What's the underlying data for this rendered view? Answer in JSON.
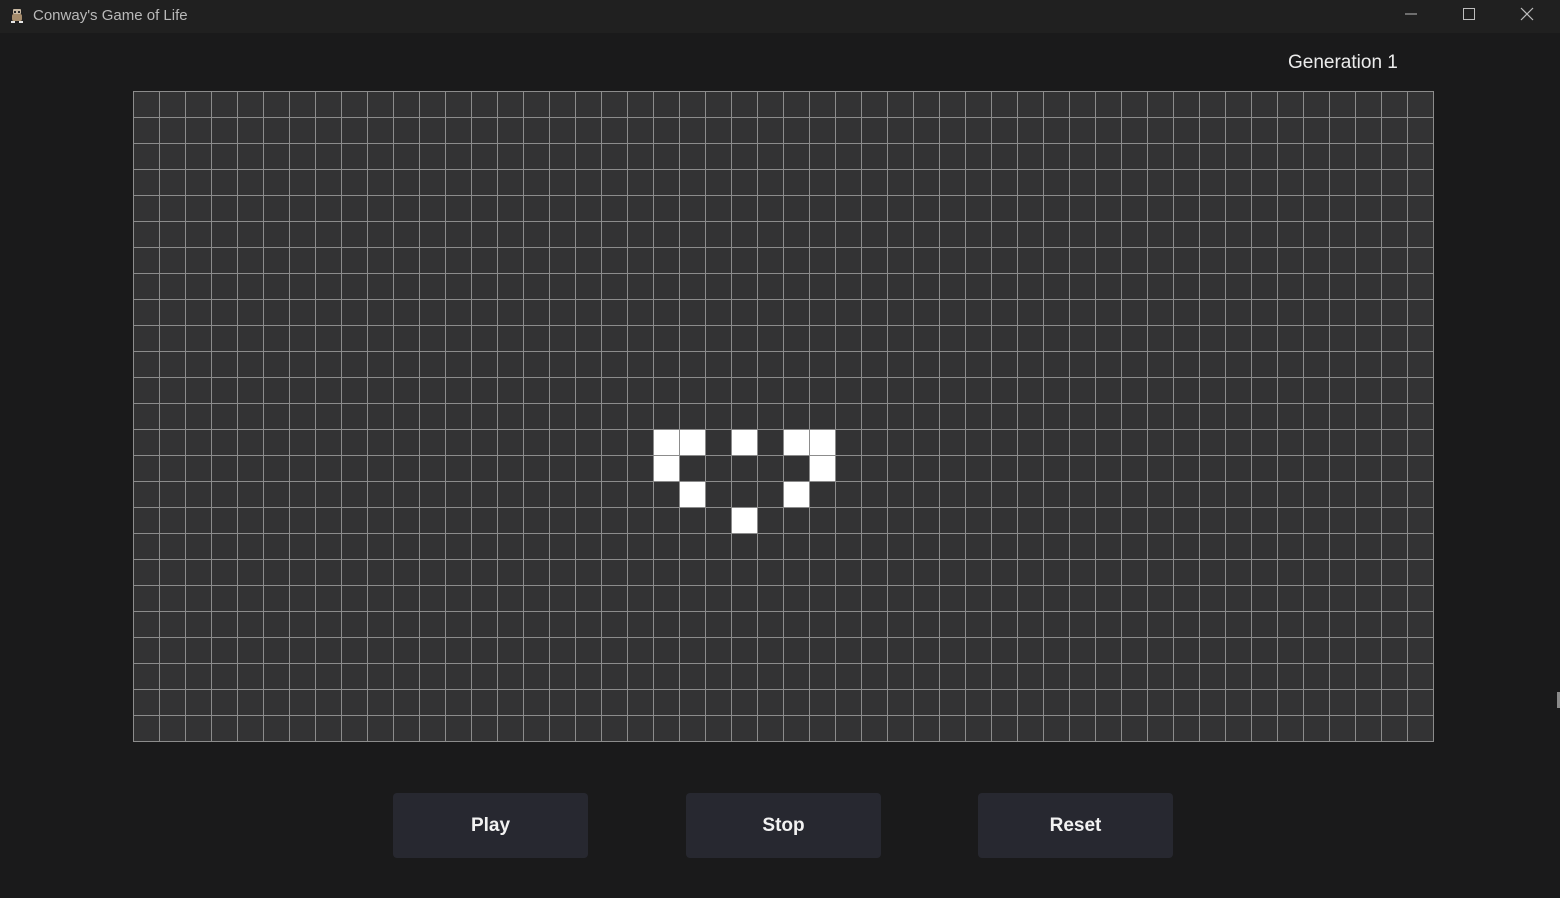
{
  "window": {
    "title": "Conway's Game of Life",
    "app_icon": "game-of-life-app-icon",
    "controls": [
      "minimize-icon",
      "maximize-icon",
      "close-icon"
    ]
  },
  "status": {
    "generation_label": "Generation 1"
  },
  "grid": {
    "columns": 50,
    "rows": 25,
    "live_cells": [
      [
        20,
        13
      ],
      [
        21,
        13
      ],
      [
        23,
        13
      ],
      [
        25,
        13
      ],
      [
        26,
        13
      ],
      [
        20,
        14
      ],
      [
        26,
        14
      ],
      [
        21,
        15
      ],
      [
        25,
        15
      ],
      [
        23,
        16
      ]
    ],
    "colors": {
      "background": "#333334",
      "grid_line": "#8c8c8c",
      "live_cell": "#ffffff"
    }
  },
  "buttons": {
    "play": "Play",
    "stop": "Stop",
    "reset": "Reset"
  },
  "colors": {
    "window_background": "#1a1a1b",
    "titlebar": "#202020",
    "button_background": "#272830"
  }
}
